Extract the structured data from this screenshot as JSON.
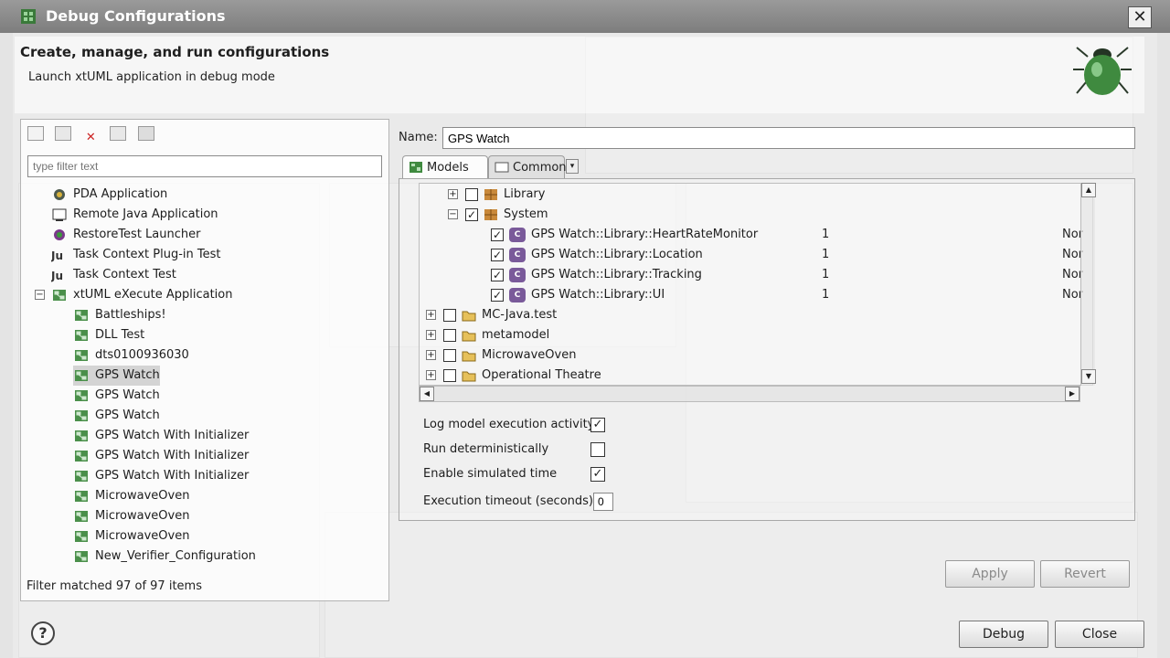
{
  "window": {
    "title": "Debug Configurations",
    "close_glyph": "✕"
  },
  "header": {
    "title": "Create, manage, and run configurations",
    "subtitle": "Launch xtUML application in debug mode"
  },
  "left": {
    "filter_placeholder": "type filter text",
    "items": [
      {
        "label": "PDA Application",
        "icon": "pda-icon"
      },
      {
        "label": "Remote Java Application",
        "icon": "remote-java-icon"
      },
      {
        "label": "RestoreTest Launcher",
        "icon": "restore-test-icon"
      },
      {
        "label": "Task Context Plug-in Test",
        "icon": "ju-plugin-icon"
      },
      {
        "label": "Task Context Test",
        "icon": "ju-test-icon"
      },
      {
        "label": "xtUML eXecute Application",
        "icon": "xtuml-execute-icon",
        "expanded": true
      },
      {
        "label": "Battleships!",
        "icon": "xtuml-config-icon"
      },
      {
        "label": "DLL Test",
        "icon": "xtuml-config-icon"
      },
      {
        "label": "dts0100936030",
        "icon": "xtuml-config-icon"
      },
      {
        "label": "GPS Watch",
        "icon": "xtuml-config-icon",
        "selected": true
      },
      {
        "label": "GPS Watch",
        "icon": "xtuml-config-icon"
      },
      {
        "label": "GPS Watch",
        "icon": "xtuml-config-icon"
      },
      {
        "label": "GPS Watch With Initializer",
        "icon": "xtuml-config-icon"
      },
      {
        "label": "GPS Watch With Initializer",
        "icon": "xtuml-config-icon"
      },
      {
        "label": "GPS Watch With Initializer",
        "icon": "xtuml-config-icon"
      },
      {
        "label": "MicrowaveOven",
        "icon": "xtuml-config-icon"
      },
      {
        "label": "MicrowaveOven",
        "icon": "xtuml-config-icon"
      },
      {
        "label": "MicrowaveOven",
        "icon": "xtuml-config-icon"
      },
      {
        "label": "New_Verifier_Configuration",
        "icon": "xtuml-config-icon"
      }
    ],
    "status": "Filter matched 97 of 97 items"
  },
  "config": {
    "name_label": "Name:",
    "name_value": "GPS Watch",
    "tabs": [
      {
        "label": "Models"
      },
      {
        "label": "Common"
      }
    ],
    "models": [
      {
        "label": "Library",
        "checked": false,
        "expander": "+",
        "kind": "folder"
      },
      {
        "label": "System",
        "checked": true,
        "expander": "−",
        "kind": "folder"
      },
      {
        "label": "GPS Watch::Library::HeartRateMonitor",
        "checked": true,
        "count": "1",
        "extra": "Nor",
        "kind": "component"
      },
      {
        "label": "GPS Watch::Library::Location",
        "checked": true,
        "count": "1",
        "extra": "Nor",
        "kind": "component"
      },
      {
        "label": "GPS Watch::Library::Tracking",
        "checked": true,
        "count": "1",
        "extra": "Nor",
        "kind": "component"
      },
      {
        "label": "GPS Watch::Library::UI",
        "checked": true,
        "count": "1",
        "extra": "Nor",
        "kind": "component"
      },
      {
        "label": "MC-Java.test",
        "checked": false,
        "expander": "+",
        "kind": "project"
      },
      {
        "label": "metamodel",
        "checked": false,
        "expander": "+",
        "kind": "project"
      },
      {
        "label": "MicrowaveOven",
        "checked": false,
        "expander": "+",
        "kind": "project"
      },
      {
        "label": "Operational Theatre",
        "checked": false,
        "expander": "+",
        "kind": "project"
      }
    ],
    "options": {
      "log_label": "Log model execution activity",
      "log_checked": true,
      "det_label": "Run deterministically",
      "det_checked": false,
      "sim_label": "Enable simulated time",
      "sim_checked": true,
      "timeout_label": "Execution timeout (seconds)",
      "timeout_value": "0"
    }
  },
  "buttons": {
    "apply": "Apply",
    "revert": "Revert",
    "debug": "Debug",
    "close": "Close",
    "help": "?"
  }
}
